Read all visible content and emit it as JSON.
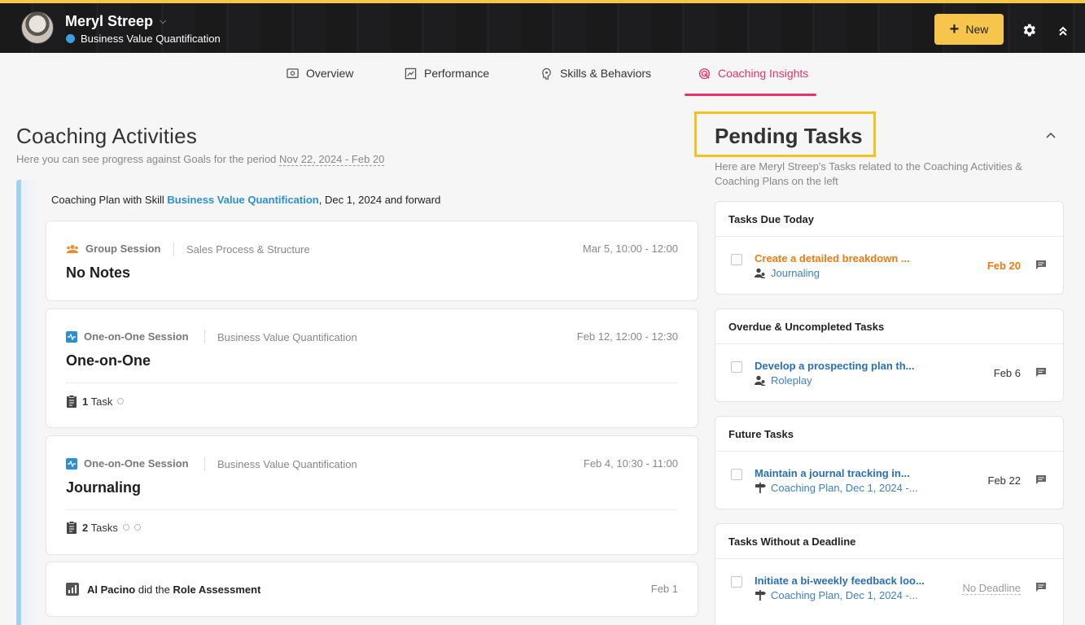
{
  "header": {
    "user_name": "Meryl Streep",
    "user_team": "Business Value Quantification",
    "new_button": "New",
    "brand_accent": "#f5c74a"
  },
  "tabs": [
    {
      "label": "Overview",
      "icon": "overview-icon",
      "active": false
    },
    {
      "label": "Performance",
      "icon": "performance-icon",
      "active": false
    },
    {
      "label": "Skills & Behaviors",
      "icon": "skills-icon",
      "active": false
    },
    {
      "label": "Coaching Insights",
      "icon": "target-icon",
      "active": true
    }
  ],
  "left": {
    "title": "Coaching Activities",
    "subtitle_prefix": "Here you can see progress against Goals for the period ",
    "period": "Nov 22, 2024 - Feb 20",
    "plan_prefix": "Coaching Plan with Skill ",
    "plan_skill": "Business Value Quantification",
    "plan_suffix": ", Dec 1, 2024 and forward",
    "cards": [
      {
        "type": "Group Session",
        "topic": "Sales Process & Structure",
        "date": "Mar 5, 10:00 - 12:00",
        "title": "No Notes"
      },
      {
        "type": "One-on-One Session",
        "topic": "Business Value Quantification",
        "date": "Feb 12, 12:00 - 12:30",
        "title": "One-on-One",
        "task_count": "1",
        "task_label": "Task"
      },
      {
        "type": "One-on-One Session",
        "topic": "Business Value Quantification",
        "date": "Feb 4, 10:30 - 11:00",
        "title": "Journaling",
        "task_count": "2",
        "task_label": "Tasks"
      },
      {
        "actor": "Al Pacino",
        "verb": " did the ",
        "object": "Role Assessment",
        "date": "Feb 1"
      }
    ]
  },
  "right": {
    "title": "Pending Tasks",
    "subtitle": "Here are Meryl Streep's Tasks related to the Coaching Activities & Coaching Plans on the left",
    "groups": [
      {
        "heading": "Tasks Due Today",
        "task": "Create a detailed breakdown ...",
        "link": "Journaling",
        "date": "Feb 20"
      },
      {
        "heading": "Overdue & Uncompleted Tasks",
        "task": "Develop a prospecting plan th...",
        "link": "Roleplay",
        "date": "Feb 6"
      },
      {
        "heading": "Future Tasks",
        "task": "Maintain a journal tracking in...",
        "link": "Coaching Plan, Dec 1, 2024 -...",
        "date": "Feb 22"
      },
      {
        "heading": "Tasks Without a Deadline",
        "task": "Initiate a bi-weekly feedback loo...",
        "link": "Coaching Plan, Dec 1, 2024 -...",
        "date": "No Deadline"
      }
    ]
  }
}
